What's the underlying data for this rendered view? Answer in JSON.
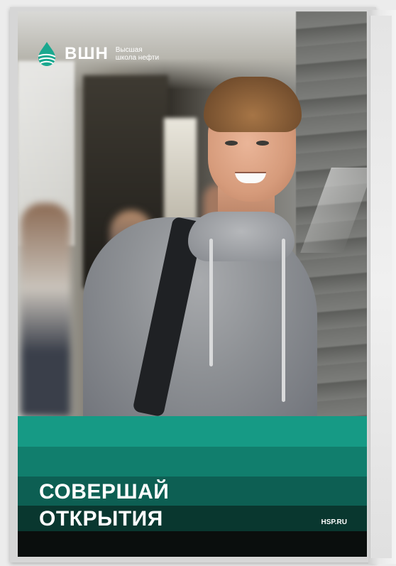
{
  "logo": {
    "abbr": "ВШН",
    "line1": "Высшая",
    "line2": "школа нефти",
    "icon": "oil-drop-icon"
  },
  "headline": {
    "line1": "СОВЕРШАЙ",
    "line2": "ОТКРЫТИЯ"
  },
  "website": "HSP.RU",
  "colors": {
    "band1": "#169a85",
    "band2": "#117e6d",
    "band3": "#0d5f53",
    "band4": "#09372f",
    "band5": "#0a0e0d",
    "text": "#ffffff"
  }
}
